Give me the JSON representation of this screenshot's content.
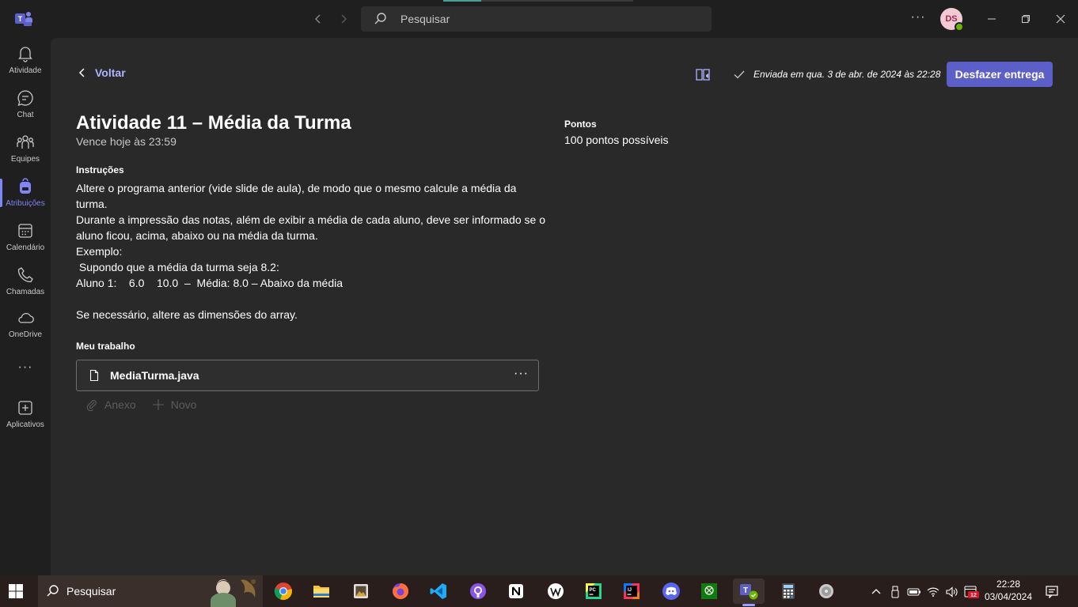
{
  "topbar": {
    "search_placeholder": "Pesquisar",
    "avatar_initials": "DS",
    "more_label": "···"
  },
  "rail": {
    "items": [
      {
        "label": "Atividade",
        "icon": "bell-icon"
      },
      {
        "label": "Chat",
        "icon": "chat-icon"
      },
      {
        "label": "Equipes",
        "icon": "teams-icon"
      },
      {
        "label": "Atribuições",
        "icon": "backpack-icon",
        "active": true
      },
      {
        "label": "Calendário",
        "icon": "calendar-icon"
      },
      {
        "label": "Chamadas",
        "icon": "phone-icon"
      },
      {
        "label": "OneDrive",
        "icon": "cloud-icon"
      },
      {
        "label": "Aplicativos",
        "icon": "add-app-icon"
      }
    ],
    "more_label": "···"
  },
  "assignment": {
    "back_label": "Voltar",
    "submitted_text": "Enviada em qua. 3 de abr. de 2024 às 22:28",
    "undo_button": "Desfazer entrega",
    "title": "Atividade 11 – Média da Turma",
    "due": "Vence hoje às 23:59",
    "points_heading": "Pontos",
    "points_value": "100 pontos possíveis",
    "instructions_heading": "Instruções",
    "instructions": [
      "Altere o programa anterior (vide slide de aula), de modo que o mesmo calcule a média da",
      "turma.",
      "Durante a impressão das notas, além de exibir a média de cada aluno, deve ser informado se o",
      "aluno ficou, acima, abaixo ou na média da turma.",
      "Exemplo:",
      " Supondo que a média da turma seja 8.2:",
      "Aluno 1:    6.0    10.0  –  Média: 8.0 – Abaixo da média",
      "",
      "Se necessário, altere as dimensões do array."
    ],
    "my_work_heading": "Meu trabalho",
    "file_name": "MediaTurma.java",
    "file_more": "···",
    "attach_label": "Anexo",
    "new_label": "Novo"
  },
  "taskbar": {
    "search_placeholder": "Pesquisar",
    "apps": [
      "chrome",
      "file-explorer",
      "photos",
      "firefox",
      "vscode",
      "github-desktop",
      "notion",
      "wikipedia",
      "pycharm",
      "intellij",
      "discord",
      "xbox",
      "teams",
      "calculator",
      "disk"
    ],
    "notification_badge": "12",
    "time": "22:28",
    "date": "03/04/2024"
  },
  "colors": {
    "accent": "#5b5fc7",
    "accent_text": "#aeb4ff",
    "background": "#292929",
    "rail": "#1f1f1f"
  }
}
